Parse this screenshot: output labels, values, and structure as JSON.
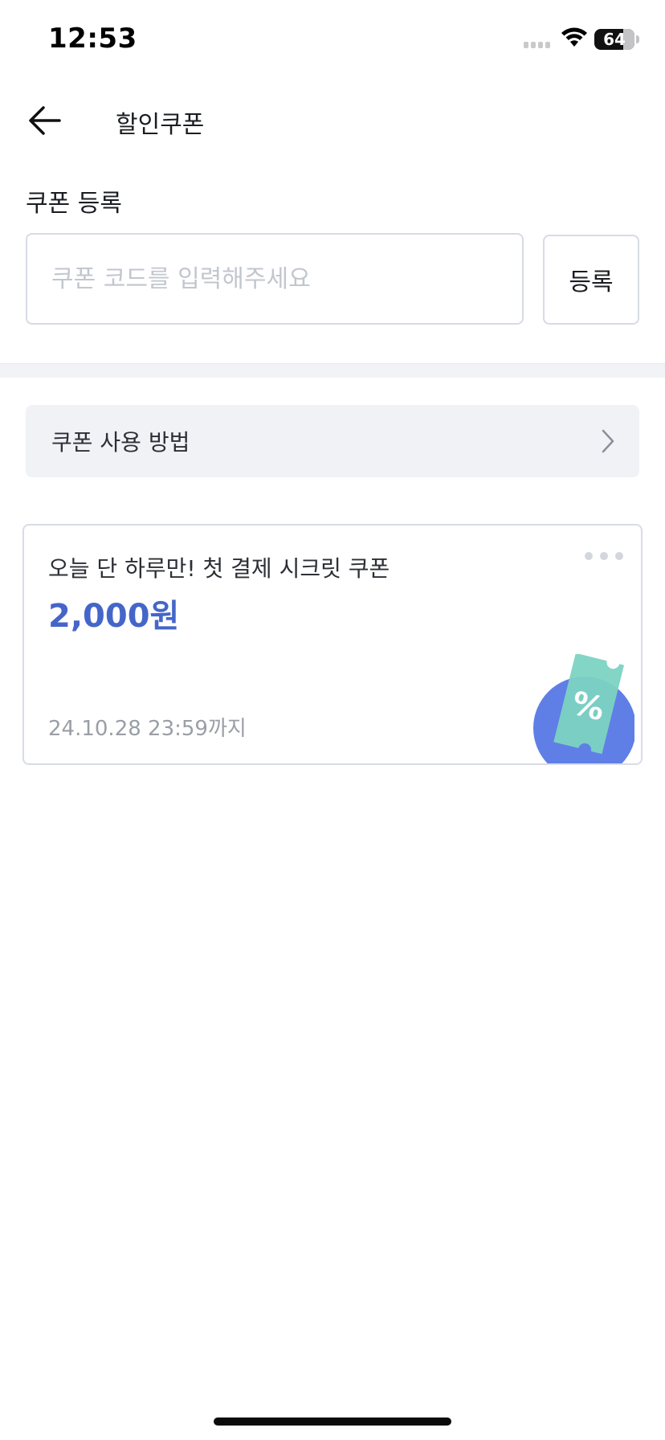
{
  "status_bar": {
    "time": "12:53",
    "battery": "64"
  },
  "header": {
    "title": "할인쿠폰"
  },
  "register": {
    "section_label": "쿠폰 등록",
    "input_placeholder": "쿠폰 코드를 입력해주세요",
    "input_value": "",
    "button_label": "등록"
  },
  "howto": {
    "label": "쿠폰 사용 방법"
  },
  "coupons": [
    {
      "title": "오늘 단 하루만! 첫 결제 시크릿 쿠폰",
      "amount": "2,000원",
      "expiry": "24.10.28 23:59까지"
    }
  ],
  "colors": {
    "accent": "#4566c9",
    "coupon_circle": "#5f7fe6",
    "ticket": "#7cd3c2"
  }
}
